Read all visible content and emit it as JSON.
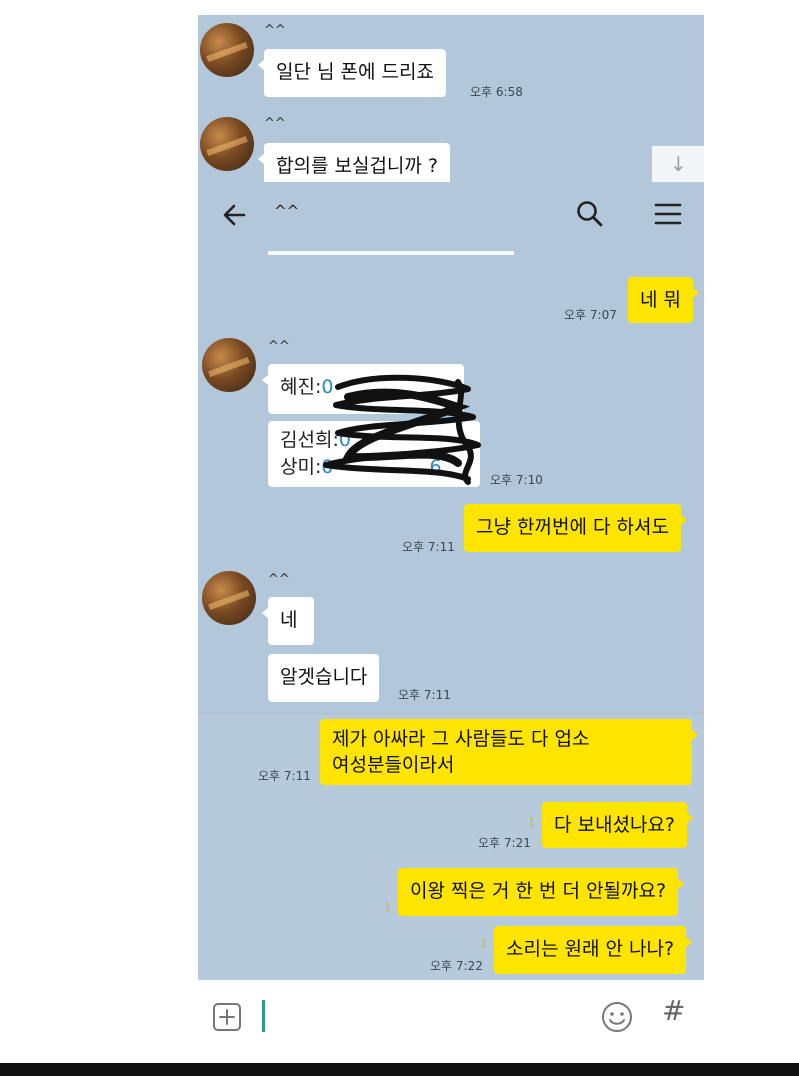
{
  "chat": {
    "contact_name": "^^",
    "messages": {
      "m1": {
        "text": "일단 님 폰에 드리죠",
        "time": "오후 6:58"
      },
      "m2": {
        "text": "합의를 보실겁니까 ?"
      },
      "m3": {
        "text": "네 뭐",
        "time": "오후 7:07"
      },
      "m4": {
        "line1_prefix": "혜진:",
        "line1_phone": "0",
        "time": "오후 7:10"
      },
      "m5": {
        "line1_prefix": "김선희:",
        "line1_phone": "0",
        "line2_prefix": "상미:",
        "line2_phone": "0",
        "line2_suffix": "6"
      },
      "m6": {
        "text": "그냥 한꺼번에 다 하셔도",
        "time": "오후 7:11"
      },
      "m7": {
        "text": "네"
      },
      "m8": {
        "text": "알겟습니다",
        "time": "오후 7:11"
      },
      "m9": {
        "line1": "제가 아싸라 그 사람들도 다 업소",
        "line2": "여성분들이라서",
        "time": "오후 7:11"
      },
      "m10": {
        "text": "다 보내셨나요?",
        "time": "오후 7:21",
        "unread": "1"
      },
      "m11": {
        "text": "이왕 찍은 거 한 번 더 안될까요?",
        "unread": "1"
      },
      "m12": {
        "text": "소리는 원래 안 나나?",
        "time": "오후 7:22",
        "unread": "1"
      }
    }
  },
  "header": {
    "title": "^^"
  },
  "icons": {
    "back": "arrow-left-icon",
    "search": "search-icon",
    "menu": "hamburger-menu-icon",
    "scroll": "arrow-down-icon",
    "plus": "plus-box-icon",
    "emoji": "smiley-icon",
    "hash": "hash-icon"
  },
  "composer": {
    "hash_symbol": "#"
  },
  "scroll_button": {
    "symbol": "↓"
  },
  "colors": {
    "chat_bg": "#b2c7d9",
    "my_bubble": "#fee500",
    "their_bubble": "#ffffff"
  }
}
